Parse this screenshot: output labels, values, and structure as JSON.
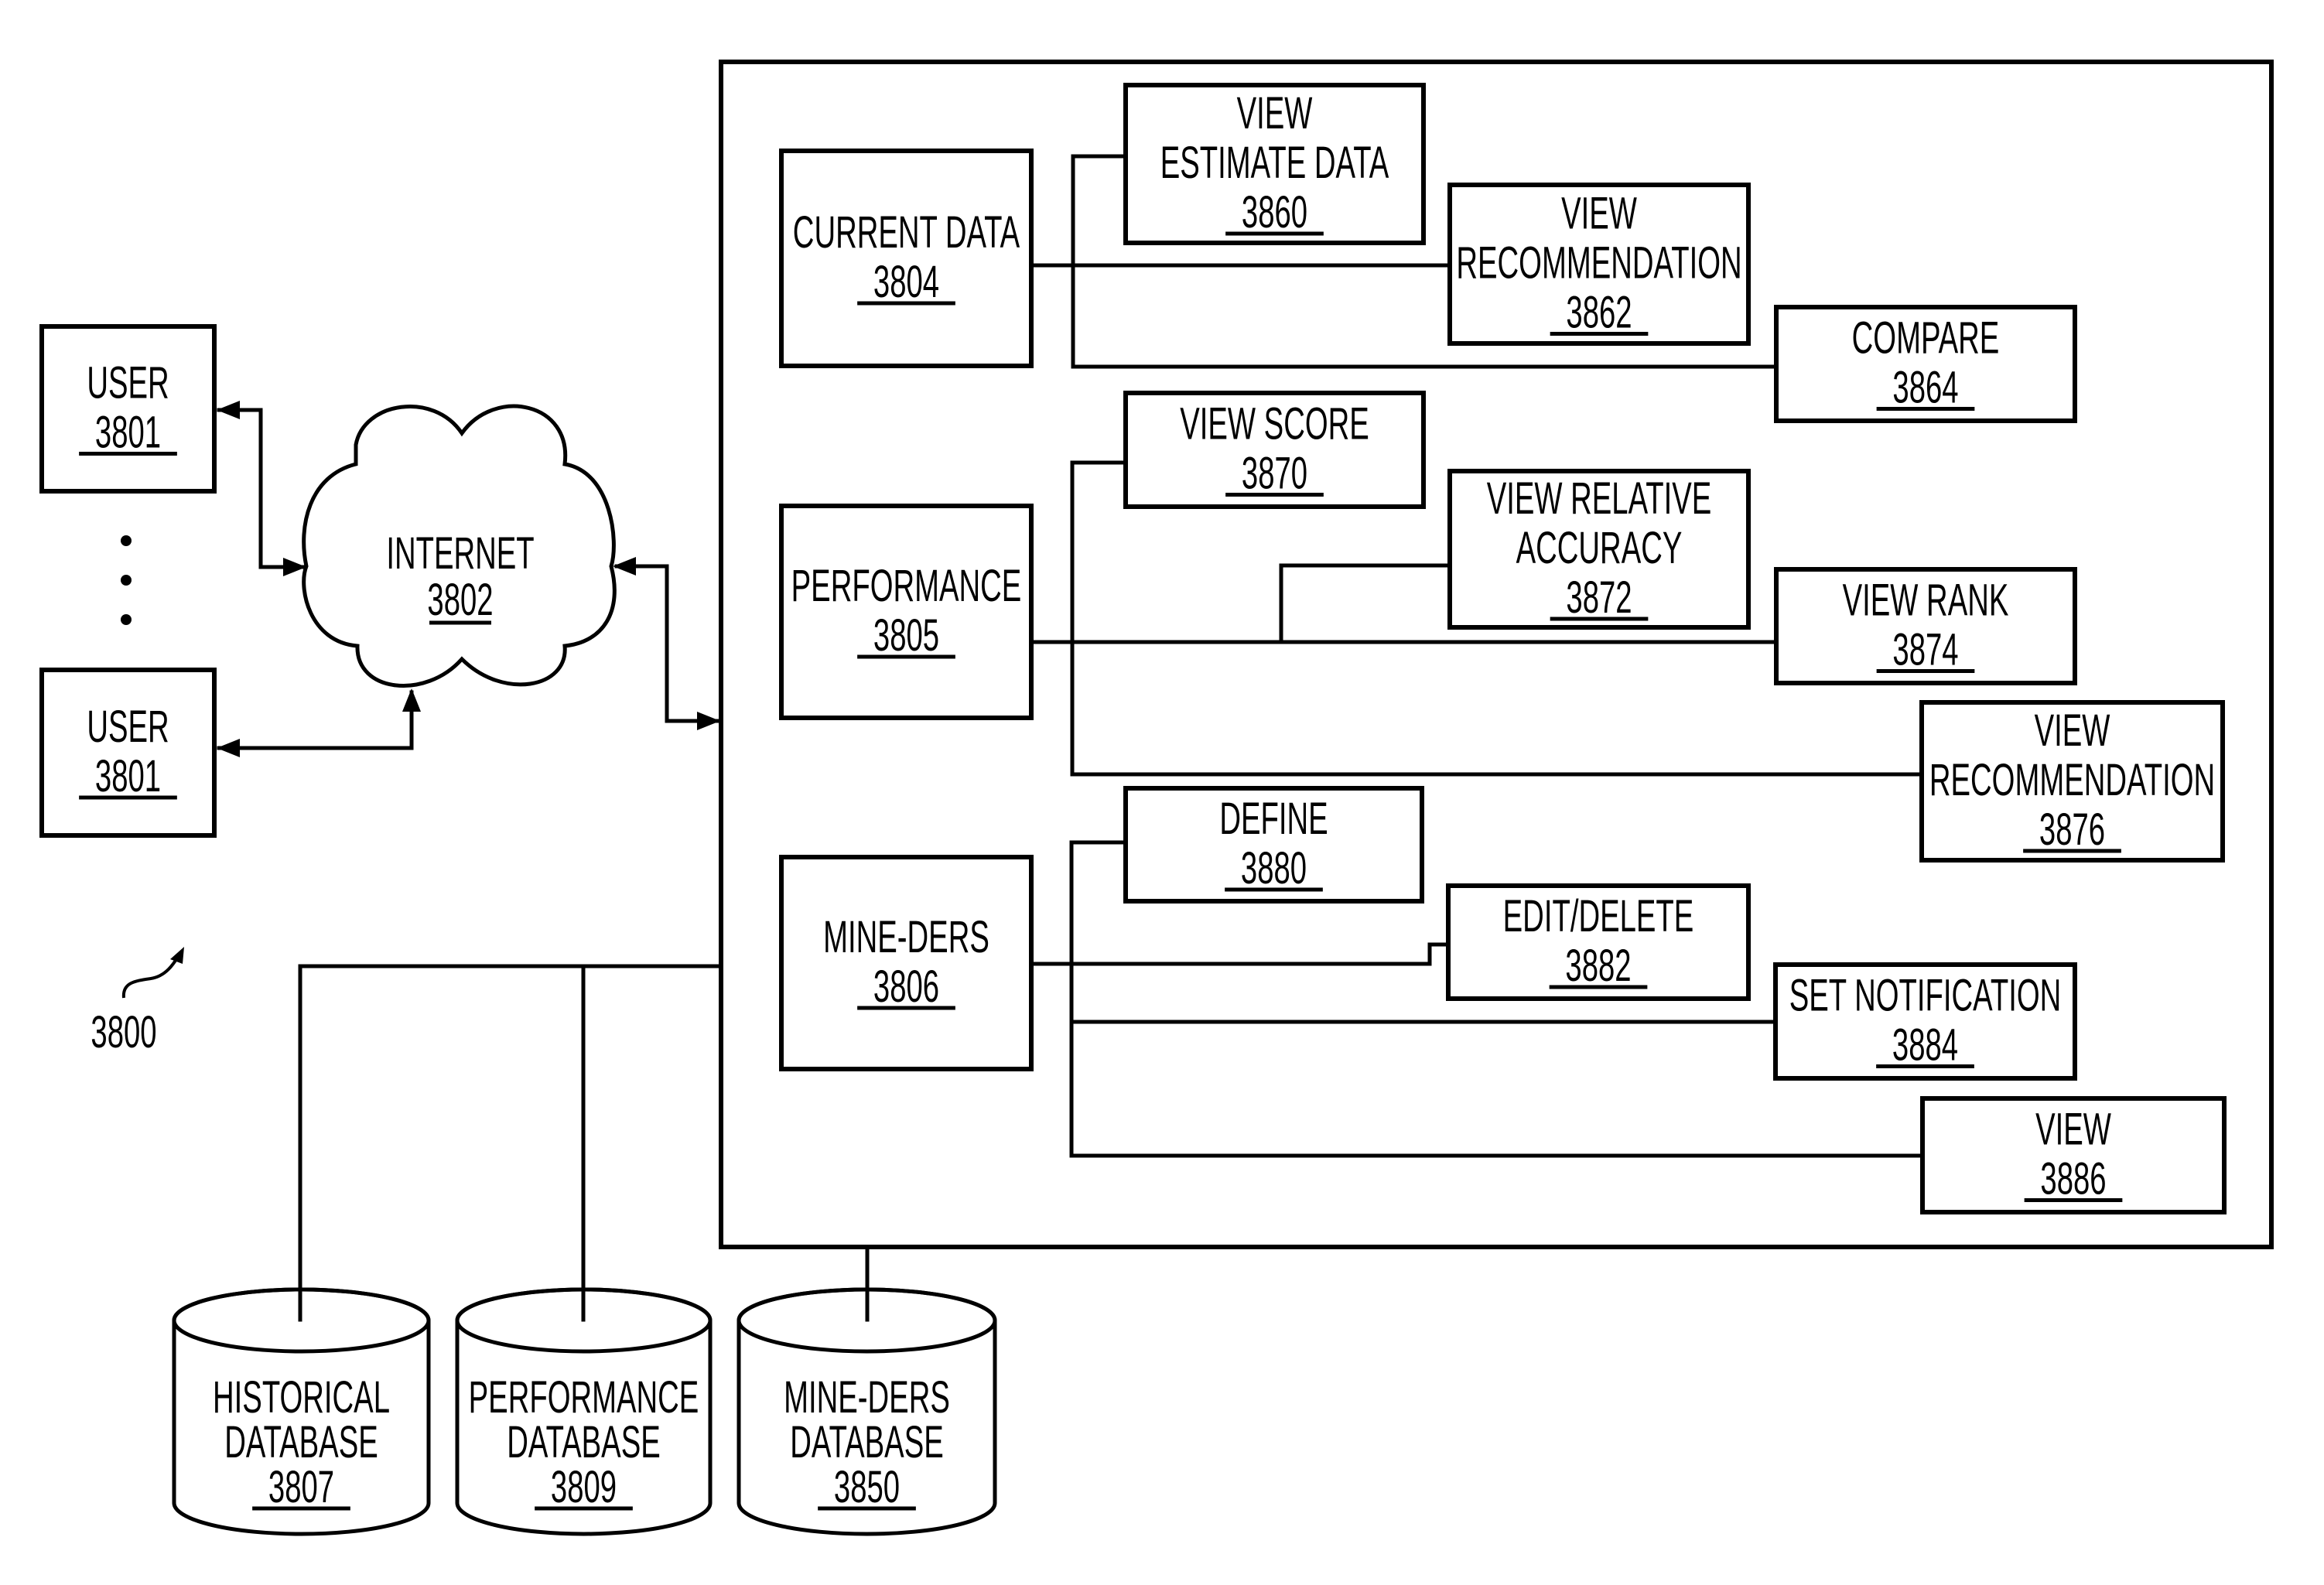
{
  "figure": {
    "reference": "3800"
  },
  "users": [
    {
      "id": "user-1",
      "label": "USER",
      "ref": "3801"
    },
    {
      "id": "user-2",
      "label": "USER",
      "ref": "3801"
    }
  ],
  "internet": {
    "label": "INTERNET",
    "ref": "3802"
  },
  "modules": [
    {
      "id": "current-data",
      "lines": [
        "CURRENT DATA"
      ],
      "ref": "3804"
    },
    {
      "id": "performance",
      "lines": [
        "PERFORMANCE"
      ],
      "ref": "3805"
    },
    {
      "id": "mine-ders",
      "lines": [
        "MINE-DERS"
      ],
      "ref": "3806"
    }
  ],
  "functions": [
    {
      "id": "view-estimate-data",
      "lines": [
        "VIEW",
        "ESTIMATE DATA"
      ],
      "ref": "3860",
      "parent": "current-data"
    },
    {
      "id": "view-recommendation-3862",
      "lines": [
        "VIEW",
        "RECOMMENDATION"
      ],
      "ref": "3862",
      "parent": "current-data"
    },
    {
      "id": "compare",
      "lines": [
        "COMPARE"
      ],
      "ref": "3864",
      "parent": "current-data"
    },
    {
      "id": "view-score",
      "lines": [
        "VIEW SCORE"
      ],
      "ref": "3870",
      "parent": "performance"
    },
    {
      "id": "view-relative-accuracy",
      "lines": [
        "VIEW RELATIVE",
        "ACCURACY"
      ],
      "ref": "3872",
      "parent": "performance"
    },
    {
      "id": "view-rank",
      "lines": [
        "VIEW RANK"
      ],
      "ref": "3874",
      "parent": "performance"
    },
    {
      "id": "view-recommendation-3876",
      "lines": [
        "VIEW",
        "RECOMMENDATION"
      ],
      "ref": "3876",
      "parent": "performance"
    },
    {
      "id": "define",
      "lines": [
        "DEFINE"
      ],
      "ref": "3880",
      "parent": "mine-ders"
    },
    {
      "id": "edit-delete",
      "lines": [
        "EDIT/DELETE"
      ],
      "ref": "3882",
      "parent": "mine-ders"
    },
    {
      "id": "set-notification",
      "lines": [
        "SET NOTIFICATION"
      ],
      "ref": "3884",
      "parent": "mine-ders"
    },
    {
      "id": "view",
      "lines": [
        "VIEW"
      ],
      "ref": "3886",
      "parent": "mine-ders"
    }
  ],
  "databases": [
    {
      "id": "historical-database",
      "lines": [
        "HISTORICAL",
        "DATABASE"
      ],
      "ref": "3807"
    },
    {
      "id": "performance-database",
      "lines": [
        "PERFORMANCE",
        "DATABASE"
      ],
      "ref": "3809"
    },
    {
      "id": "mine-ders-database",
      "lines": [
        "MINE-DERS",
        "DATABASE"
      ],
      "ref": "3850"
    }
  ],
  "continuation_dots": 3
}
